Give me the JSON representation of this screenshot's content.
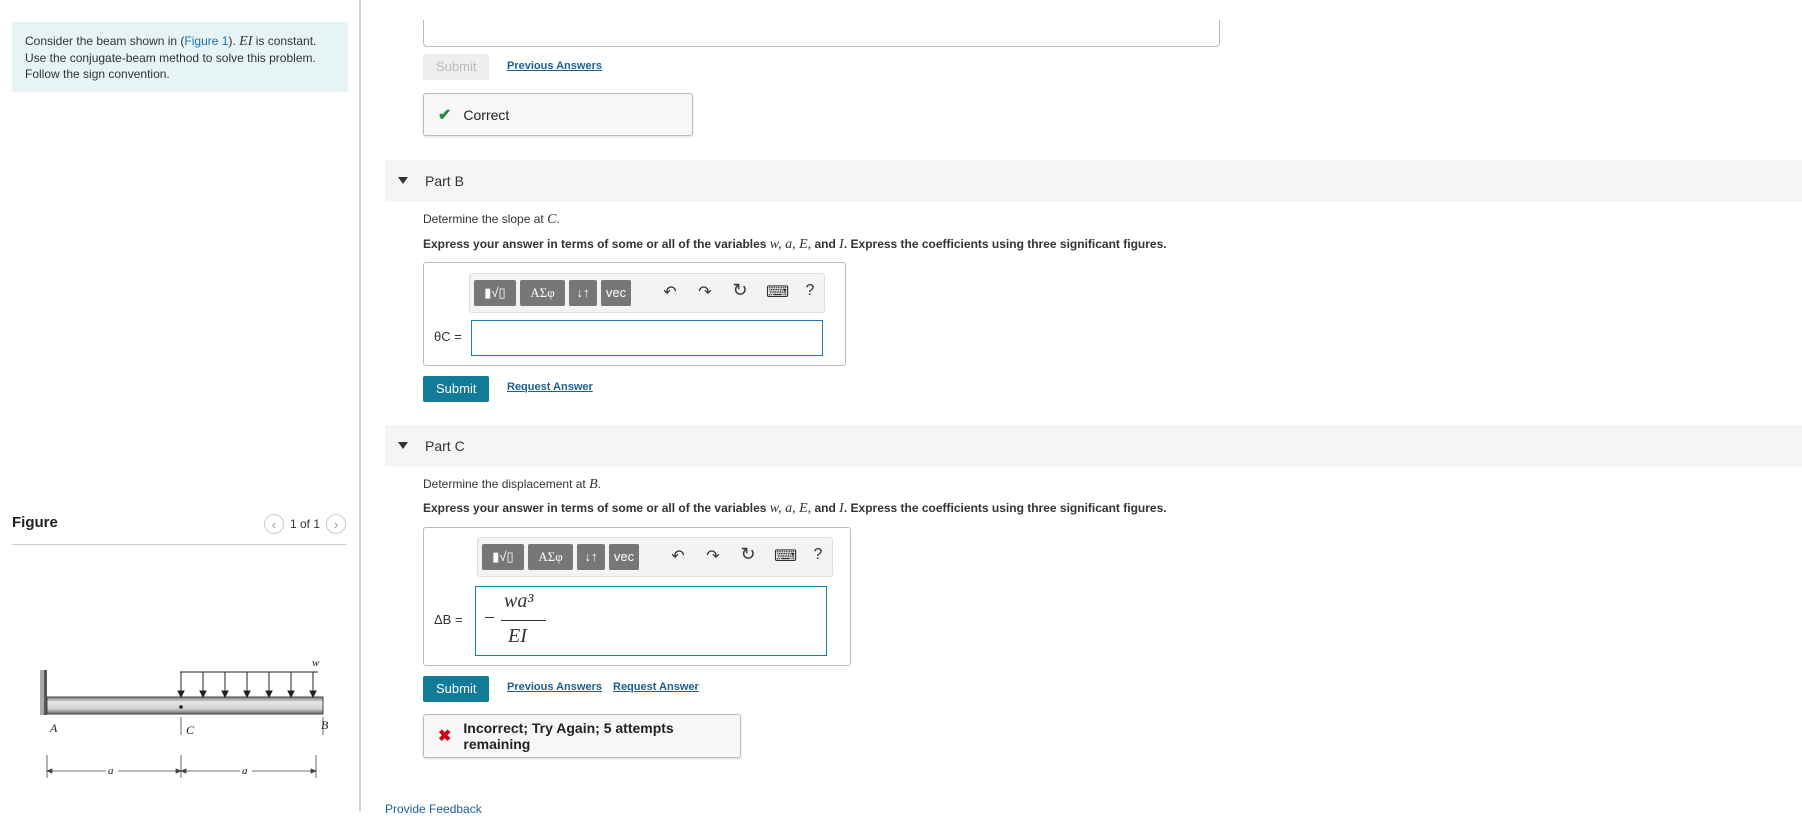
{
  "problem": {
    "line1_pre": "Consider the beam shown in (",
    "figure_link": "Figure 1",
    "line1_post": ").",
    "ei": "EI",
    "line1_end": " is constant.",
    "line2": "Use the conjugate-beam method to solve this problem.",
    "line3": "Follow the sign convention."
  },
  "figure": {
    "title": "Figure",
    "pager": "1 of 1",
    "labels": {
      "A": "A",
      "C": "C",
      "B": "B",
      "w": "w",
      "a1": "a",
      "a2": "a"
    }
  },
  "part_a": {
    "submit": "Submit",
    "previous_answers": "Previous Answers",
    "feedback": "Correct"
  },
  "part_b": {
    "title": "Part B",
    "question_pre": "Determine the slope at ",
    "question_var": "C",
    "question_post": ".",
    "instruction_pre": "Express your answer in terms of some or all of the variables ",
    "instruction_vars": "w, a, E,",
    "instruction_and": " and ",
    "instruction_I": "I",
    "instruction_post": ". Express the coefficients using three significant figures.",
    "var_label": "θC =",
    "submit": "Submit",
    "request_answer": "Request Answer"
  },
  "part_c": {
    "title": "Part C",
    "question_pre": "Determine the displacement at ",
    "question_var": "B",
    "question_post": ".",
    "instruction_pre": "Express your answer in terms of some or all of the variables ",
    "instruction_vars": "w, a, E,",
    "instruction_and": " and ",
    "instruction_I": "I",
    "instruction_post": ". Express the coefficients using three significant figures.",
    "var_label": "ΔB =",
    "answer_sign": "−",
    "answer_num": "wa³",
    "answer_den": "EI",
    "submit": "Submit",
    "previous_answers": "Previous Answers",
    "request_answer": "Request Answer",
    "feedback": "Incorrect; Try Again; 5 attempts remaining"
  },
  "toolbar": {
    "templates": "▮√▯",
    "greek": "ΑΣφ",
    "arrows": "↓↑",
    "vec": "vec",
    "undo": "↶",
    "redo": "↷",
    "reset": "↻",
    "keyboard": "⌨",
    "help": "?"
  },
  "footer": {
    "feedback_link": "Provide Feedback"
  },
  "colors": {
    "accent": "#117b98",
    "correct": "#2b8a3e",
    "incorrect": "#d0021b",
    "link": "#1a5f96"
  }
}
